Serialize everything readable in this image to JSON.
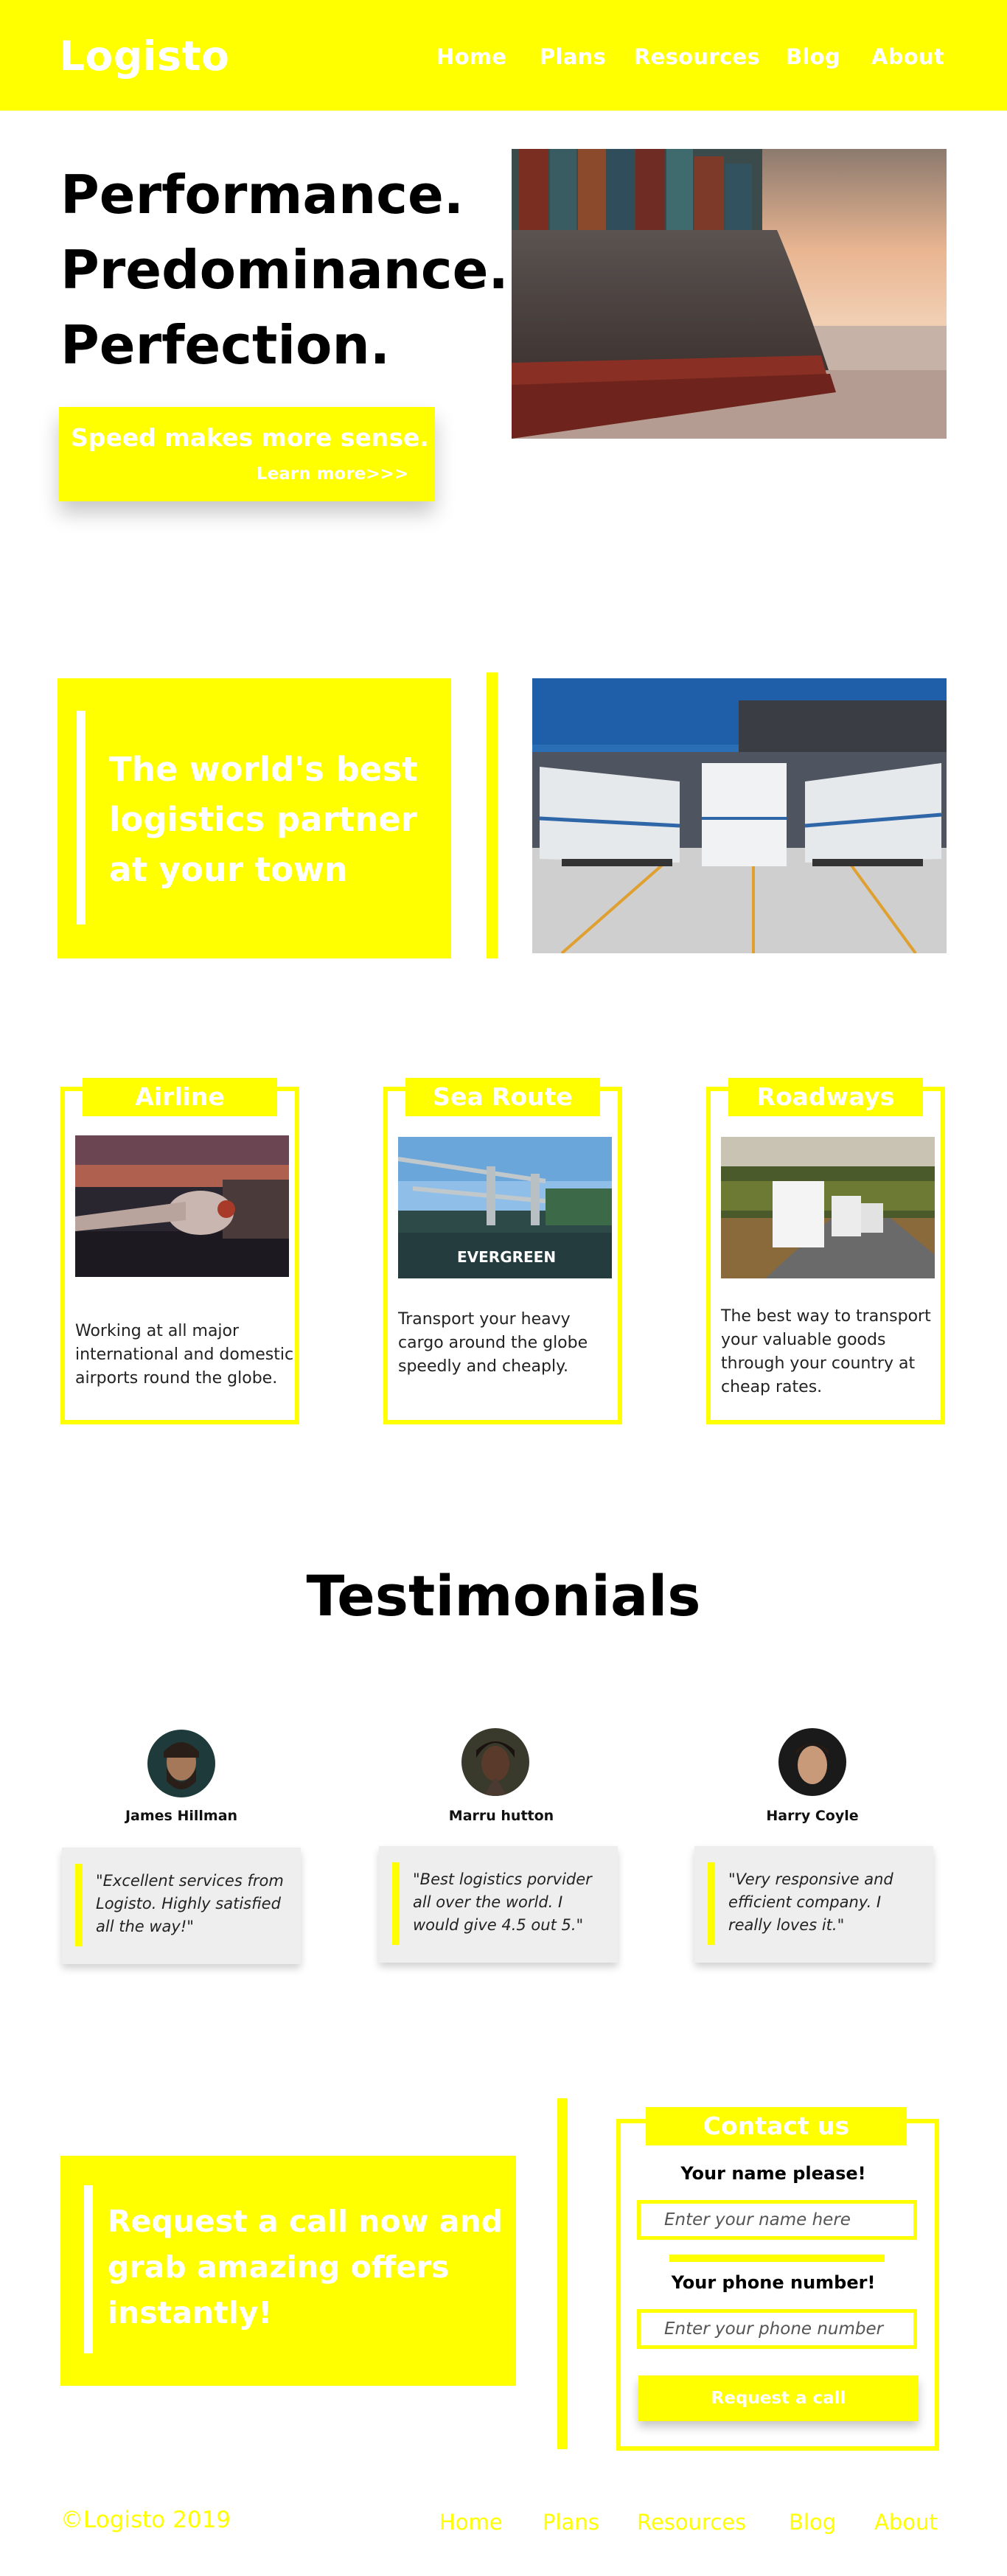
{
  "brand": {
    "name": "Logisto",
    "color": "#ffff00"
  },
  "nav": {
    "home": "Home",
    "plans": "Plans",
    "resources": "Resources",
    "blog": "Blog",
    "about": "About"
  },
  "hero": {
    "line1": "Performance.",
    "line2": "Predominance.",
    "line3": "Perfection.",
    "cta_title": "Speed makes more sense.",
    "cta_link": "Learn more>>>",
    "image_icon": "container-ship-photo"
  },
  "partner": {
    "text": "The world's best logistics partner at your town",
    "image_icon": "truck-trailers-photo"
  },
  "services": [
    {
      "title": "Airline",
      "text": "Working at all major international and domestic airports round the globe.",
      "image_icon": "airplane-photo"
    },
    {
      "title": "Sea Route",
      "text": "Transport your heavy cargo around the globe speedly and cheaply.",
      "image_icon": "port-cranes-photo",
      "ship_label": "EVERGREEN"
    },
    {
      "title": "Roadways",
      "text": "The best way to transport your valuable goods through your country at cheap rates.",
      "image_icon": "trucks-road-photo"
    }
  ],
  "testimonials": {
    "heading": "Testimonials",
    "items": [
      {
        "name": "James Hillman",
        "quote": "\"Excellent services from Logisto. Highly satisfied all the way!\""
      },
      {
        "name": "Marru hutton",
        "quote": "\"Best logistics porvider all over the world. I would give 4.5 out 5.\""
      },
      {
        "name": "Harry Coyle",
        "quote": "\"Very responsive and efficient company. I really loves it.\""
      }
    ]
  },
  "request": {
    "text": "Request a call now and grab amazing offers instantly!"
  },
  "contact": {
    "title": "Contact us",
    "name_label": "Your name please!",
    "name_placeholder": "Enter your name here",
    "phone_label": "Your phone number!",
    "phone_placeholder": "Enter your phone number",
    "submit": "Request a call"
  },
  "footer": {
    "copyright": "©Logisto 2019",
    "home": "Home",
    "plans": "Plans",
    "resources": "Resources",
    "blog": "Blog",
    "about": "About"
  }
}
